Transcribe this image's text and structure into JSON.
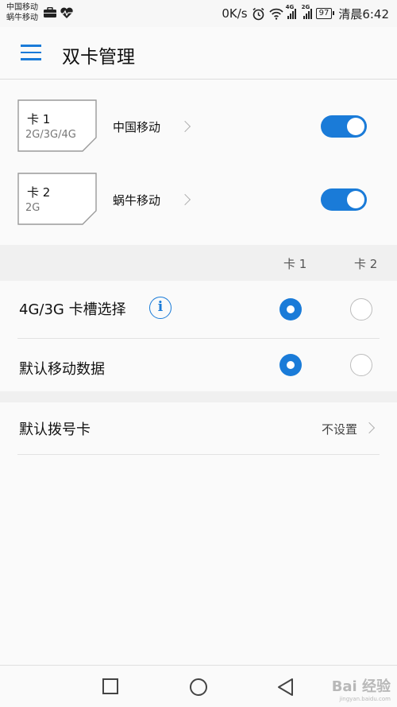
{
  "status_bar": {
    "carrier1": "中国移动",
    "carrier2": "蜗牛移动",
    "speed": "0K/s",
    "battery": "97",
    "time": "清晨6:42",
    "signal1_tag": "4G",
    "signal2_tag": "2G"
  },
  "app_bar": {
    "title": "双卡管理"
  },
  "sims": [
    {
      "name": "卡 1",
      "network": "2G/3G/4G",
      "carrier": "中国移动",
      "enabled": true
    },
    {
      "name": "卡 2",
      "network": "2G",
      "carrier": "蜗牛移动",
      "enabled": true
    }
  ],
  "card_columns": [
    "卡 1",
    "卡 2"
  ],
  "options": [
    {
      "label": "4G/3G 卡槽选择",
      "selected": "卡 1"
    },
    {
      "label": "默认移动数据",
      "selected": "卡 1"
    }
  ],
  "default_dial": {
    "label": "默认拨号卡",
    "value": "不设置"
  },
  "watermark": {
    "brand": "Bai 经验",
    "url": "jingyan.baidu.com"
  },
  "accent_color": "#1a7bd8"
}
